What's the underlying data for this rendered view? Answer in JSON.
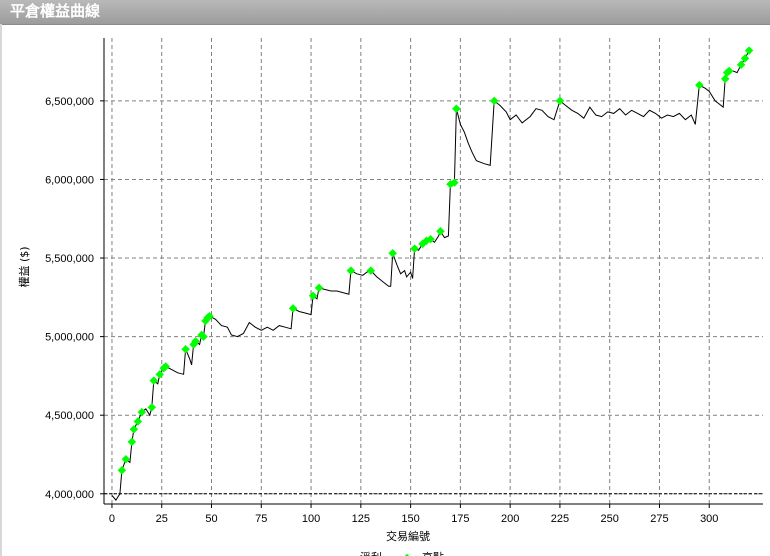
{
  "window": {
    "title": "平倉權益曲線"
  },
  "chart_data": {
    "type": "line",
    "title": "平倉權益曲線",
    "xlabel": "交易編號",
    "ylabel": "權益 ($)",
    "xlim": [
      -4,
      327
    ],
    "ylim": [
      3935000,
      6900000
    ],
    "x_ticks": [
      0,
      25,
      50,
      75,
      100,
      125,
      150,
      175,
      200,
      225,
      250,
      275,
      300
    ],
    "y_ticks": [
      4000000,
      4500000,
      5000000,
      5500000,
      6000000,
      6500000
    ],
    "x_tick_labels": [
      "0",
      "25",
      "50",
      "75",
      "100",
      "125",
      "150",
      "175",
      "200",
      "225",
      "250",
      "275",
      "300"
    ],
    "y_tick_labels": [
      "4,000,000",
      "4,500,000",
      "5,000,000",
      "5,500,000",
      "6,000,000",
      "6,500,000"
    ],
    "grid": true,
    "baseline": 4000000,
    "line_color": "#000000",
    "marker_color": "#00ff00",
    "legend": [
      {
        "label": "淨利",
        "color": "#000000",
        "kind": "line"
      },
      {
        "label": "高點",
        "color": "#00ff00",
        "kind": "marker"
      }
    ],
    "series": [
      {
        "name": "淨利",
        "points": [
          [
            0,
            3990000
          ],
          [
            2,
            3960000
          ],
          [
            4,
            4000000
          ],
          [
            5,
            4150000
          ],
          [
            7,
            4220000
          ],
          [
            9,
            4200000
          ],
          [
            10,
            4330000
          ],
          [
            11,
            4410000
          ],
          [
            13,
            4460000
          ],
          [
            15,
            4520000
          ],
          [
            17,
            4540000
          ],
          [
            19,
            4500000
          ],
          [
            20,
            4550000
          ],
          [
            21,
            4720000
          ],
          [
            23,
            4700000
          ],
          [
            24,
            4760000
          ],
          [
            26,
            4800000
          ],
          [
            27,
            4810000
          ],
          [
            30,
            4790000
          ],
          [
            33,
            4770000
          ],
          [
            36,
            4760000
          ],
          [
            37,
            4920000
          ],
          [
            39,
            4860000
          ],
          [
            40,
            4820000
          ],
          [
            41,
            4950000
          ],
          [
            42,
            4970000
          ],
          [
            44,
            4950000
          ],
          [
            45,
            5010000
          ],
          [
            46,
            5000000
          ],
          [
            47,
            5100000
          ],
          [
            48,
            5120000
          ],
          [
            49,
            5130000
          ],
          [
            52,
            5110000
          ],
          [
            55,
            5070000
          ],
          [
            58,
            5060000
          ],
          [
            60,
            5010000
          ],
          [
            63,
            5000000
          ],
          [
            66,
            5020000
          ],
          [
            69,
            5090000
          ],
          [
            72,
            5060000
          ],
          [
            75,
            5040000
          ],
          [
            78,
            5060000
          ],
          [
            81,
            5040000
          ],
          [
            84,
            5070000
          ],
          [
            87,
            5060000
          ],
          [
            90,
            5050000
          ],
          [
            91,
            5180000
          ],
          [
            94,
            5160000
          ],
          [
            97,
            5150000
          ],
          [
            100,
            5140000
          ],
          [
            101,
            5260000
          ],
          [
            103,
            5240000
          ],
          [
            104,
            5310000
          ],
          [
            107,
            5300000
          ],
          [
            110,
            5290000
          ],
          [
            113,
            5290000
          ],
          [
            116,
            5280000
          ],
          [
            119,
            5270000
          ],
          [
            120,
            5420000
          ],
          [
            123,
            5400000
          ],
          [
            126,
            5390000
          ],
          [
            128,
            5410000
          ],
          [
            130,
            5420000
          ],
          [
            133,
            5380000
          ],
          [
            136,
            5350000
          ],
          [
            139,
            5320000
          ],
          [
            140,
            5320000
          ],
          [
            141,
            5530000
          ],
          [
            143,
            5460000
          ],
          [
            145,
            5400000
          ],
          [
            147,
            5420000
          ],
          [
            148,
            5380000
          ],
          [
            150,
            5410000
          ],
          [
            151,
            5370000
          ],
          [
            152,
            5560000
          ],
          [
            154,
            5550000
          ],
          [
            156,
            5590000
          ],
          [
            158,
            5610000
          ],
          [
            160,
            5620000
          ],
          [
            162,
            5600000
          ],
          [
            164,
            5640000
          ],
          [
            165,
            5670000
          ],
          [
            167,
            5630000
          ],
          [
            169,
            5640000
          ],
          [
            170,
            5970000
          ],
          [
            171,
            5960000
          ],
          [
            172,
            5980000
          ],
          [
            173,
            6450000
          ],
          [
            175,
            6350000
          ],
          [
            177,
            6300000
          ],
          [
            179,
            6230000
          ],
          [
            181,
            6170000
          ],
          [
            183,
            6120000
          ],
          [
            185,
            6110000
          ],
          [
            187,
            6100000
          ],
          [
            190,
            6090000
          ],
          [
            192,
            6500000
          ],
          [
            195,
            6470000
          ],
          [
            198,
            6430000
          ],
          [
            200,
            6380000
          ],
          [
            203,
            6410000
          ],
          [
            206,
            6360000
          ],
          [
            210,
            6400000
          ],
          [
            213,
            6450000
          ],
          [
            216,
            6440000
          ],
          [
            219,
            6400000
          ],
          [
            222,
            6380000
          ],
          [
            225,
            6500000
          ],
          [
            228,
            6470000
          ],
          [
            231,
            6440000
          ],
          [
            234,
            6420000
          ],
          [
            237,
            6390000
          ],
          [
            240,
            6460000
          ],
          [
            243,
            6410000
          ],
          [
            246,
            6400000
          ],
          [
            249,
            6430000
          ],
          [
            252,
            6420000
          ],
          [
            255,
            6450000
          ],
          [
            258,
            6410000
          ],
          [
            261,
            6440000
          ],
          [
            264,
            6420000
          ],
          [
            267,
            6400000
          ],
          [
            270,
            6440000
          ],
          [
            273,
            6420000
          ],
          [
            276,
            6390000
          ],
          [
            279,
            6410000
          ],
          [
            282,
            6400000
          ],
          [
            285,
            6420000
          ],
          [
            288,
            6380000
          ],
          [
            291,
            6410000
          ],
          [
            293,
            6350000
          ],
          [
            295,
            6600000
          ],
          [
            298,
            6580000
          ],
          [
            300,
            6560000
          ],
          [
            303,
            6500000
          ],
          [
            305,
            6480000
          ],
          [
            307,
            6460000
          ],
          [
            308,
            6640000
          ],
          [
            309,
            6680000
          ],
          [
            310,
            6690000
          ],
          [
            312,
            6690000
          ],
          [
            314,
            6680000
          ],
          [
            316,
            6730000
          ],
          [
            318,
            6770000
          ],
          [
            320,
            6820000
          ]
        ]
      },
      {
        "name": "高點",
        "points": [
          [
            5,
            4150000
          ],
          [
            7,
            4220000
          ],
          [
            10,
            4330000
          ],
          [
            11,
            4410000
          ],
          [
            13,
            4460000
          ],
          [
            15,
            4520000
          ],
          [
            20,
            4550000
          ],
          [
            21,
            4720000
          ],
          [
            24,
            4760000
          ],
          [
            26,
            4800000
          ],
          [
            27,
            4810000
          ],
          [
            37,
            4920000
          ],
          [
            41,
            4950000
          ],
          [
            42,
            4970000
          ],
          [
            45,
            5010000
          ],
          [
            46,
            5000000
          ],
          [
            47,
            5100000
          ],
          [
            48,
            5120000
          ],
          [
            49,
            5130000
          ],
          [
            91,
            5180000
          ],
          [
            101,
            5260000
          ],
          [
            104,
            5310000
          ],
          [
            120,
            5420000
          ],
          [
            130,
            5420000
          ],
          [
            141,
            5530000
          ],
          [
            152,
            5560000
          ],
          [
            156,
            5590000
          ],
          [
            158,
            5610000
          ],
          [
            160,
            5620000
          ],
          [
            165,
            5670000
          ],
          [
            170,
            5970000
          ],
          [
            172,
            5980000
          ],
          [
            173,
            6450000
          ],
          [
            192,
            6500000
          ],
          [
            225,
            6500000
          ],
          [
            295,
            6600000
          ],
          [
            308,
            6640000
          ],
          [
            309,
            6680000
          ],
          [
            310,
            6690000
          ],
          [
            316,
            6730000
          ],
          [
            318,
            6770000
          ],
          [
            320,
            6820000
          ]
        ]
      }
    ]
  }
}
